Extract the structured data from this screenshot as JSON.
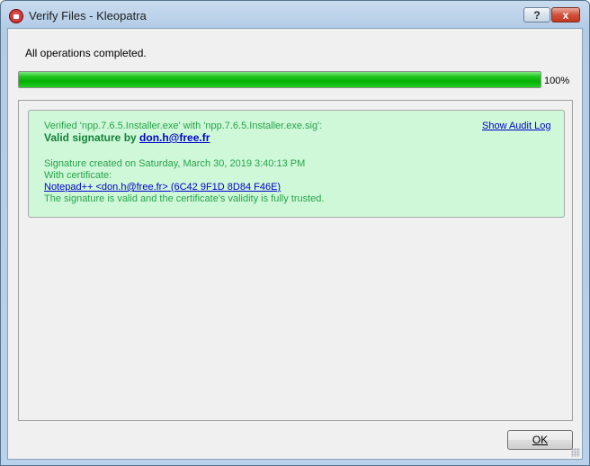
{
  "window": {
    "title": "Verify Files - Kleopatra",
    "help_label": "?",
    "close_label": "x"
  },
  "status": {
    "message": "All operations completed.",
    "progress_percent": 100,
    "progress_label": "100%"
  },
  "result": {
    "line1": "Verified 'npp.7.6.5.Installer.exe' with 'npp.7.6.5.Installer.exe.sig':",
    "valid_prefix": "Valid signature by ",
    "signer_email": "don.h@free.fr",
    "created": "Signature created on Saturday, March 30, 2019 3:40:13 PM",
    "with_cert": "With certificate:",
    "certificate": "Notepad++ <don.h@free.fr> (6C42 9F1D 8D84 F46E)",
    "validity": "The signature is valid and the certificate's validity is fully trusted.",
    "audit_log_label": "Show Audit Log"
  },
  "buttons": {
    "ok_label": "OK"
  },
  "colors": {
    "result_background": "#cff8d8",
    "result_text": "#25a34a",
    "progress_green": "#06b006",
    "link": "#0000cc"
  }
}
